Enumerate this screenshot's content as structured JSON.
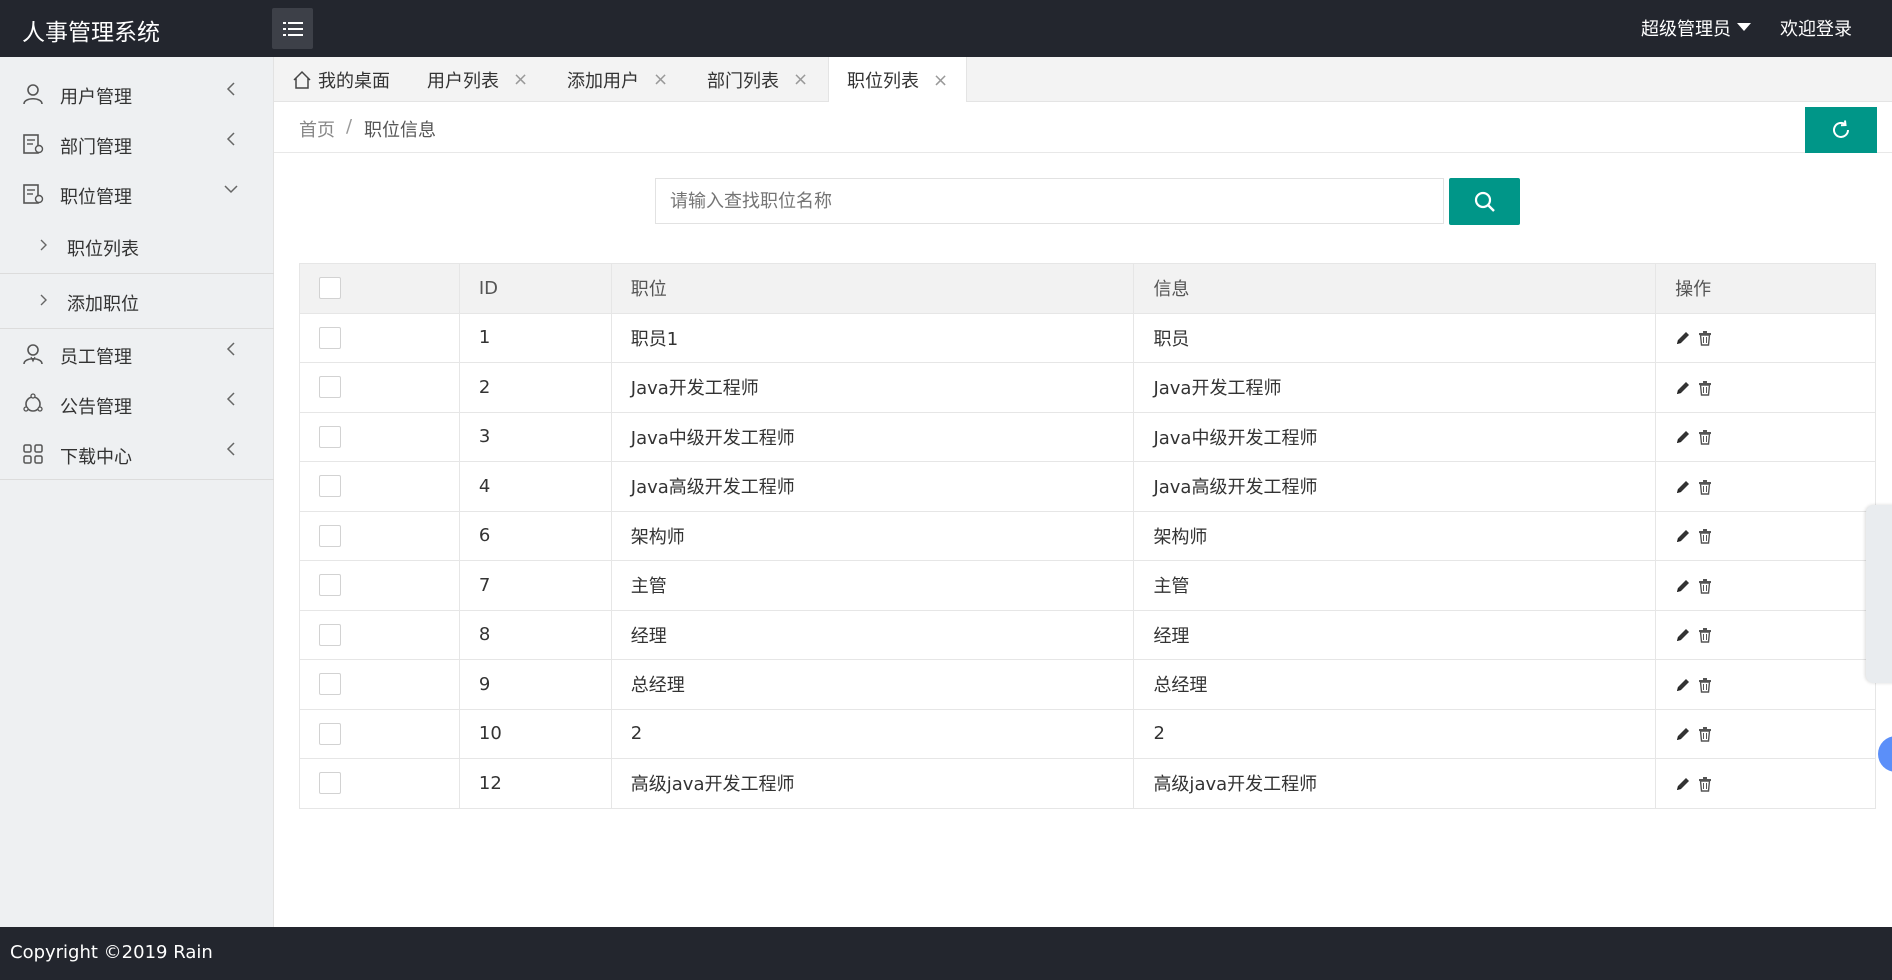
{
  "app": {
    "title": "人事管理系统"
  },
  "header": {
    "user_label": "超级管理员",
    "welcome_label": "欢迎登录"
  },
  "sidebar": {
    "items": [
      {
        "label": "用户管理",
        "icon": "user-icon",
        "expanded": false
      },
      {
        "label": "部门管理",
        "icon": "department-icon",
        "expanded": false
      },
      {
        "label": "职位管理",
        "icon": "position-icon",
        "expanded": true,
        "children": [
          {
            "label": "职位列表"
          },
          {
            "label": "添加职位"
          }
        ]
      },
      {
        "label": "员工管理",
        "icon": "employee-icon",
        "expanded": false
      },
      {
        "label": "公告管理",
        "icon": "notice-icon",
        "expanded": false
      },
      {
        "label": "下载中心",
        "icon": "download-grid-icon",
        "expanded": false
      }
    ]
  },
  "tabs": [
    {
      "label": "我的桌面",
      "closable": false
    },
    {
      "label": "用户列表",
      "closable": true,
      "close": "×"
    },
    {
      "label": "添加用户",
      "closable": true,
      "close": "×"
    },
    {
      "label": "部门列表",
      "closable": true,
      "close": "×"
    },
    {
      "label": "职位列表",
      "closable": true,
      "close": "×",
      "active": true
    }
  ],
  "breadcrumb": {
    "home": "首页",
    "separator": "/",
    "current": "职位信息"
  },
  "search": {
    "placeholder": "请输入查找职位名称",
    "value": ""
  },
  "table": {
    "columns": [
      "",
      "ID",
      "职位",
      "信息",
      "操作"
    ],
    "rows": [
      {
        "id": "1",
        "name": "职员1",
        "info": "职员"
      },
      {
        "id": "2",
        "name": "Java开发工程师",
        "info": "Java开发工程师"
      },
      {
        "id": "3",
        "name": "Java中级开发工程师",
        "info": "Java中级开发工程师"
      },
      {
        "id": "4",
        "name": "Java高级开发工程师",
        "info": "Java高级开发工程师"
      },
      {
        "id": "6",
        "name": "架构师",
        "info": "架构师"
      },
      {
        "id": "7",
        "name": "主管",
        "info": "主管"
      },
      {
        "id": "8",
        "name": "经理",
        "info": "经理"
      },
      {
        "id": "9",
        "name": "总经理",
        "info": "总经理"
      },
      {
        "id": "10",
        "name": "2",
        "info": "2"
      },
      {
        "id": "12",
        "name": "高级java开发工程师",
        "info": "高级java开发工程师"
      }
    ]
  },
  "footer": {
    "copyright": "Copyright ©2019 Rain"
  },
  "colors": {
    "header_bg": "#23262e",
    "accent": "#009688",
    "sidebar_bg": "#eef0f2"
  }
}
